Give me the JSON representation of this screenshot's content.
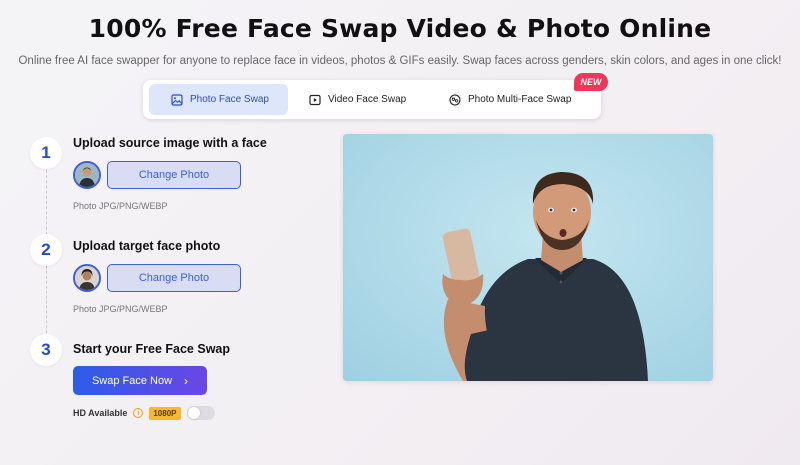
{
  "header": {
    "title": "100% Free Face Swap Video & Photo Online",
    "subtitle": "Online free AI face swapper for anyone to replace face in videos, photos & GIFs easily. Swap faces across genders, skin colors, and ages in one click!"
  },
  "tabs": [
    {
      "label": "Photo Face Swap",
      "icon": "image-icon",
      "active": true
    },
    {
      "label": "Video Face Swap",
      "icon": "video-play-icon",
      "active": false
    },
    {
      "label": "Photo Multi-Face Swap",
      "icon": "multi-face-icon",
      "active": false
    }
  ],
  "new_badge": "NEW",
  "steps": [
    {
      "number": "1",
      "title": "Upload source image with a face",
      "button": "Change Photo",
      "hint": "Photo JPG/PNG/WEBP"
    },
    {
      "number": "2",
      "title": "Upload target face photo",
      "button": "Change Photo",
      "hint": "Photo JPG/PNG/WEBP"
    },
    {
      "number": "3",
      "title": "Start your Free Face Swap"
    }
  ],
  "swap_button": {
    "label": "Swap Face Now",
    "icon": "chevron-right-icon"
  },
  "hd": {
    "label": "HD Available",
    "badge": "1080P",
    "enabled": false
  },
  "colors": {
    "accent": "#3b5fd8",
    "button_gradient_start": "#2c5de8",
    "button_gradient_end": "#6b46e6",
    "new_badge": "#f2365a",
    "hd_badge": "#f6b733",
    "preview_background": "#b5dde9"
  }
}
